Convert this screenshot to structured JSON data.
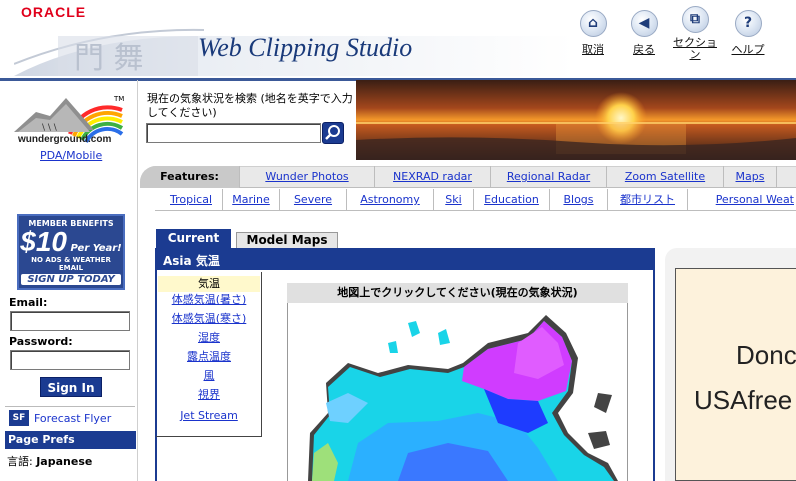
{
  "header": {
    "brand": "ORACLE",
    "title": "Web Clipping Studio",
    "tools": [
      {
        "icon": "home-icon",
        "label": "取消"
      },
      {
        "icon": "back-icon",
        "label": "戻る"
      },
      {
        "icon": "session-icon",
        "label": "セクション"
      },
      {
        "icon": "help-icon",
        "label": "ヘルプ"
      }
    ]
  },
  "left": {
    "logo_text": "wunderground.com",
    "logo_tm": "TM",
    "pda_link": "PDA/Mobile",
    "member": {
      "top": "MEMBER BENEFITS",
      "price": "$10",
      "per": "Per Year!",
      "noads": "NO ADS & WEATHER EMAIL",
      "signup": "SIGN UP TODAY"
    },
    "email_label": "Email:",
    "password_label": "Password:",
    "signin_label": "Sign In",
    "forecast_flyer": "Forecast Flyer",
    "page_prefs": "Page Prefs",
    "language_label": "言語:",
    "language_value": "Japanese"
  },
  "search": {
    "prompt": "現在の気象状況を検索 (地名を英字で入力してください)",
    "value": ""
  },
  "nav": {
    "features_label": "Features:",
    "row1": [
      "Wunder Photos",
      "NEXRAD radar",
      "Regional Radar",
      "Zoom Satellite",
      "Maps"
    ],
    "row2": [
      "Tropical",
      "Marine",
      "Severe",
      "Astronomy",
      "Ski",
      "Education",
      "Blogs",
      "都市リスト",
      "Personal Weat"
    ]
  },
  "tabs": {
    "current": "Current",
    "model": "Model Maps"
  },
  "panel": {
    "title": "Asia 気温",
    "menu": [
      "気温",
      "体感気温(暑さ)",
      "体感気温(寒さ)",
      "湿度",
      "露点温度",
      "風",
      "視界",
      "Jet Stream"
    ],
    "map_title": "地図上でクリックしてください(現在の気象状況)"
  },
  "ad": {
    "line1": "Donc",
    "line2": "USAfree"
  },
  "colors": {
    "navy": "#1b3b91",
    "oracle_red": "#e0001b",
    "link": "#1a33cc"
  }
}
